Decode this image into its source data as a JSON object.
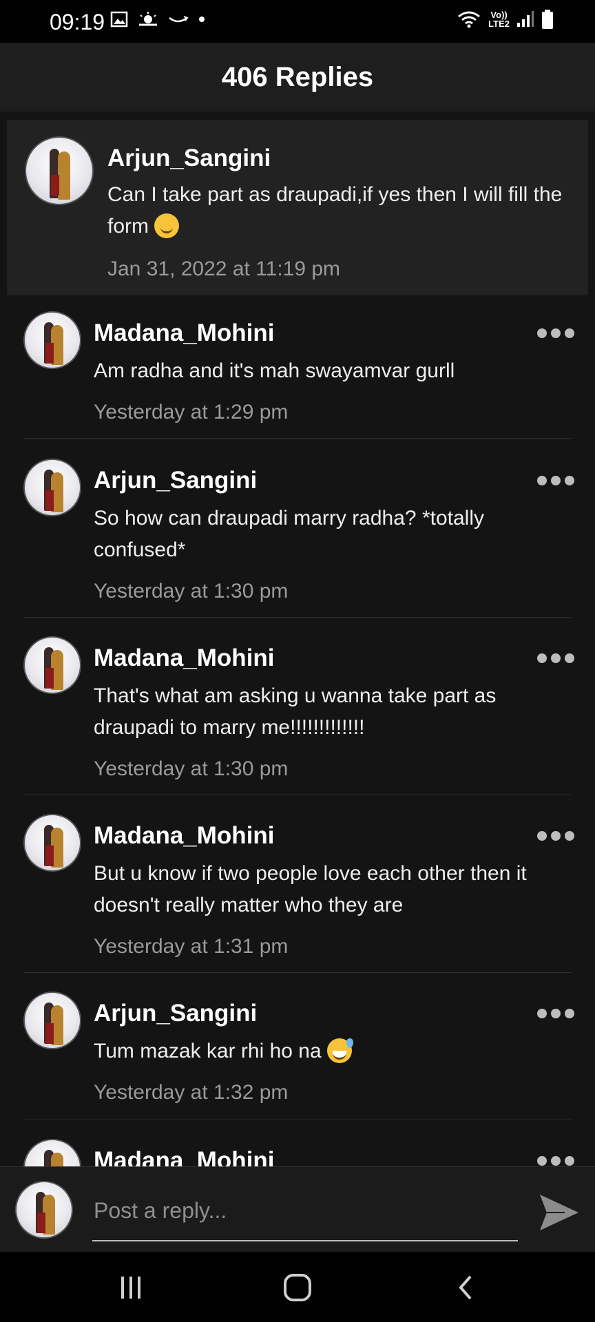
{
  "status_bar": {
    "time": "09:19",
    "network": "LTE2",
    "volte": "Vo))"
  },
  "header": {
    "title": "406 Replies"
  },
  "parent_comment": {
    "username": "Arjun_Sangini",
    "text": "Can I take part as draupadi,if yes then I will fill the form",
    "emoji": "smiling-face",
    "timestamp": "Jan 31, 2022 at 11:19 pm"
  },
  "replies": [
    {
      "username": "Madana_Mohini",
      "text": "Am radha and it's mah swayamvar gurll",
      "timestamp": "Yesterday at 1:29 pm"
    },
    {
      "username": "Arjun_Sangini",
      "text": "So how can draupadi marry radha? *totally confused*",
      "timestamp": "Yesterday at 1:30 pm"
    },
    {
      "username": "Madana_Mohini",
      "text": "That's what am asking u wanna take part as draupadi to marry me!!!!!!!!!!!!!",
      "timestamp": "Yesterday at 1:30 pm"
    },
    {
      "username": "Madana_Mohini",
      "text": "But u know if two people love each other then it doesn't really matter who they are",
      "timestamp": "Yesterday at 1:31 pm"
    },
    {
      "username": "Arjun_Sangini",
      "text": "Tum mazak kar rhi ho na",
      "emoji": "grinning-sweat",
      "timestamp": "Yesterday at 1:32 pm"
    },
    {
      "username": "Madana_Mohini"
    }
  ],
  "reply_bar": {
    "placeholder": "Post a reply..."
  },
  "colors": {
    "background": "#141414",
    "header": "#1e1e1e",
    "accent_text": "#ffffff",
    "muted_text": "#9a9a9a"
  }
}
